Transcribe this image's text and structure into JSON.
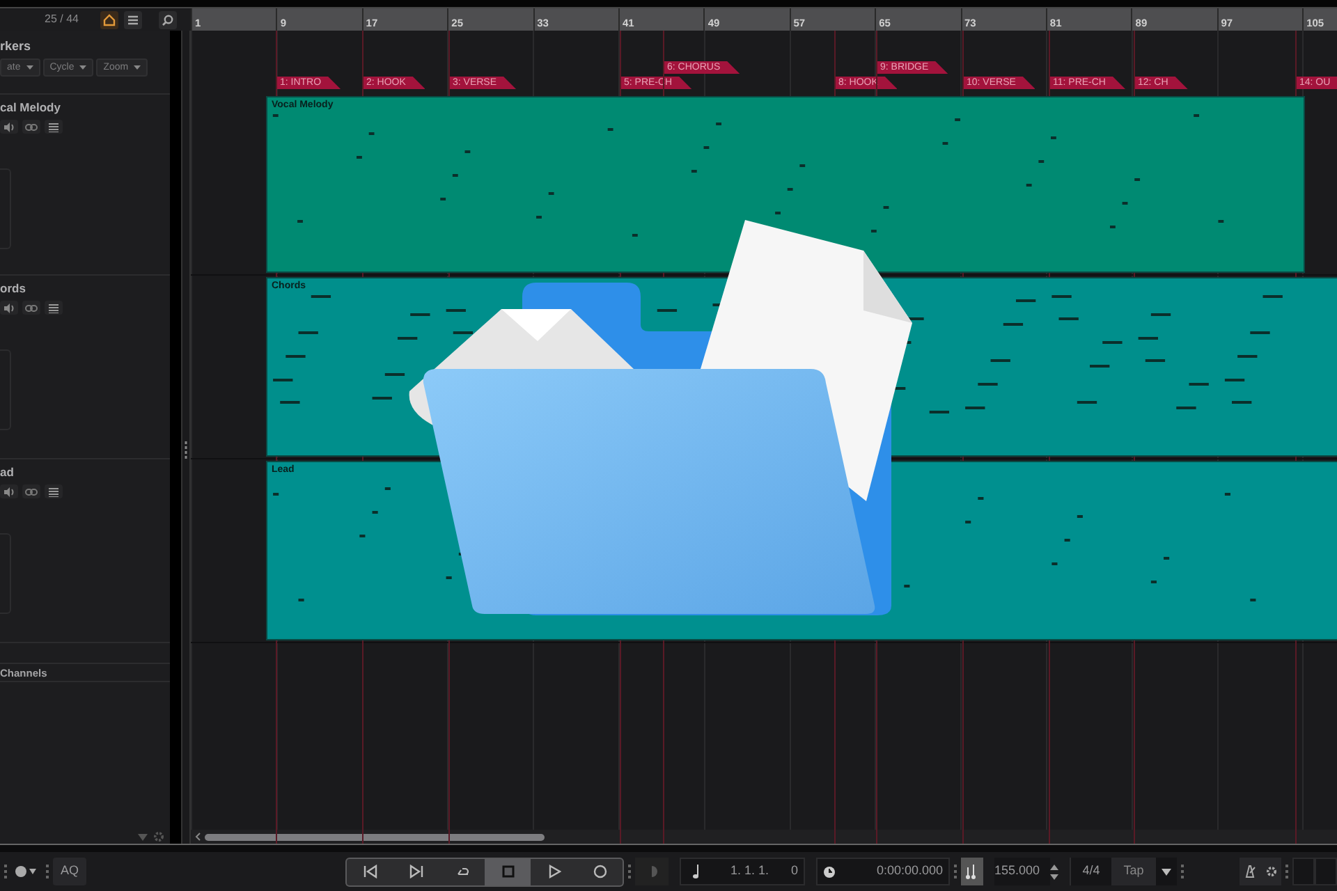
{
  "toolbar": {
    "counter": "25 / 44"
  },
  "ruler": {
    "bars": [
      "1",
      "9",
      "17",
      "25",
      "33",
      "41",
      "49",
      "57",
      "65",
      "73",
      "81",
      "89",
      "97",
      "105"
    ]
  },
  "marker_panel": {
    "title": "rkers",
    "dropdowns": [
      "ate",
      "Cycle",
      "Zoom"
    ]
  },
  "markers": [
    {
      "label": "1: INTRO"
    },
    {
      "label": "2: HOOK"
    },
    {
      "label": "3: VERSE"
    },
    {
      "label": "5: PRE-CH"
    },
    {
      "label": "6: CHORUS"
    },
    {
      "label": "8: HOOK"
    },
    {
      "label": "9: BRIDGE"
    },
    {
      "label": "10: VERSE"
    },
    {
      "label": "11: PRE-CH"
    },
    {
      "label": "12: CH"
    },
    {
      "label": "14: OU"
    }
  ],
  "tracks": [
    {
      "name": "cal Melody",
      "clip_title": "Vocal Melody",
      "color": "#008a72"
    },
    {
      "name": "ords",
      "clip_title": "Chords",
      "color": "#008f8c"
    },
    {
      "name": "ad",
      "clip_title": "Lead",
      "color": "#00908f"
    }
  ],
  "channels_label": "Channels",
  "transport": {
    "quantize": "AQ",
    "buttons": [
      {
        "kind": "rewind",
        "selected": false
      },
      {
        "kind": "forward",
        "selected": false
      },
      {
        "kind": "loop",
        "selected": false
      },
      {
        "kind": "stop",
        "selected": true
      },
      {
        "kind": "play",
        "selected": false
      },
      {
        "kind": "record",
        "selected": false
      }
    ],
    "position": "1. 1. 1.",
    "position_ticks": "0",
    "time": "0:00:00.000",
    "tempo": "155.000",
    "signature": "4/4",
    "tap": "Tap"
  }
}
